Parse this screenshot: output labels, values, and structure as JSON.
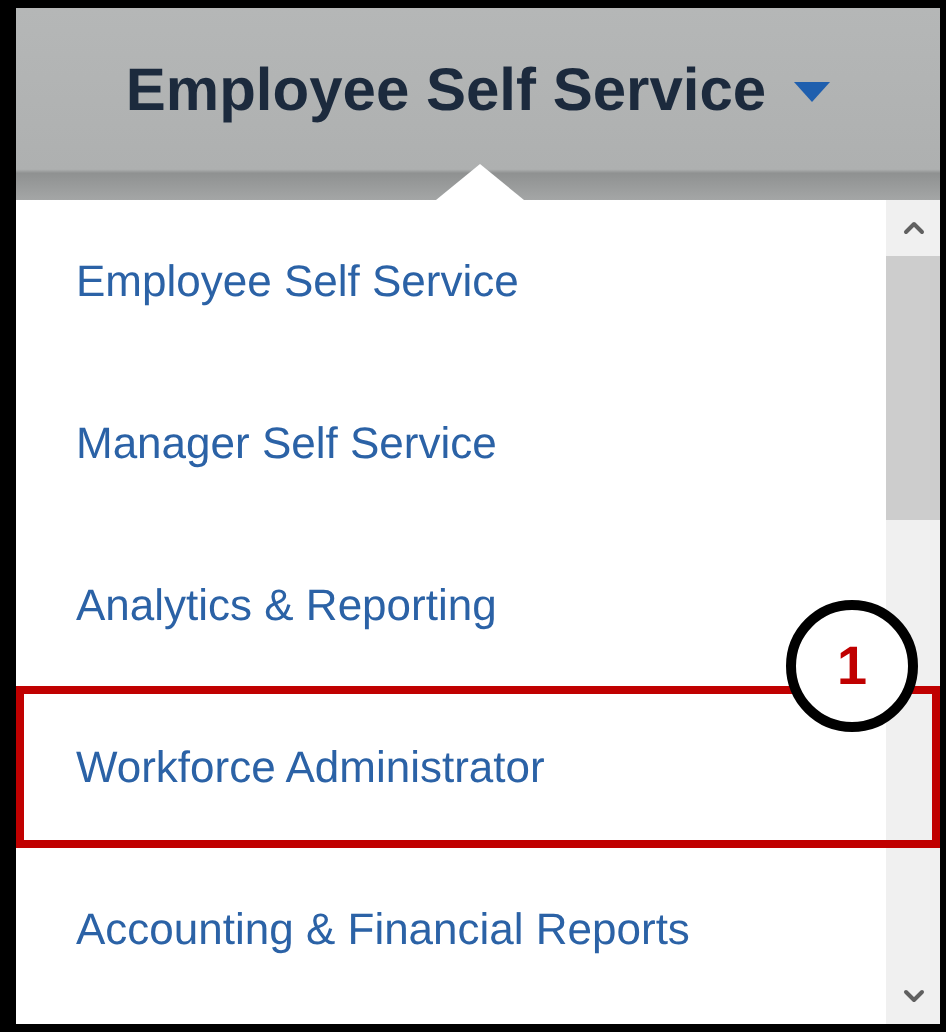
{
  "header": {
    "title": "Employee Self Service"
  },
  "menu_items": [
    {
      "label": "Employee Self Service",
      "highlighted": false
    },
    {
      "label": "Manager Self Service",
      "highlighted": false
    },
    {
      "label": "Analytics & Reporting",
      "highlighted": false
    },
    {
      "label": "Workforce Administrator",
      "highlighted": true
    },
    {
      "label": "Accounting & Financial Reports",
      "highlighted": false
    }
  ],
  "callout": {
    "number": "1"
  }
}
